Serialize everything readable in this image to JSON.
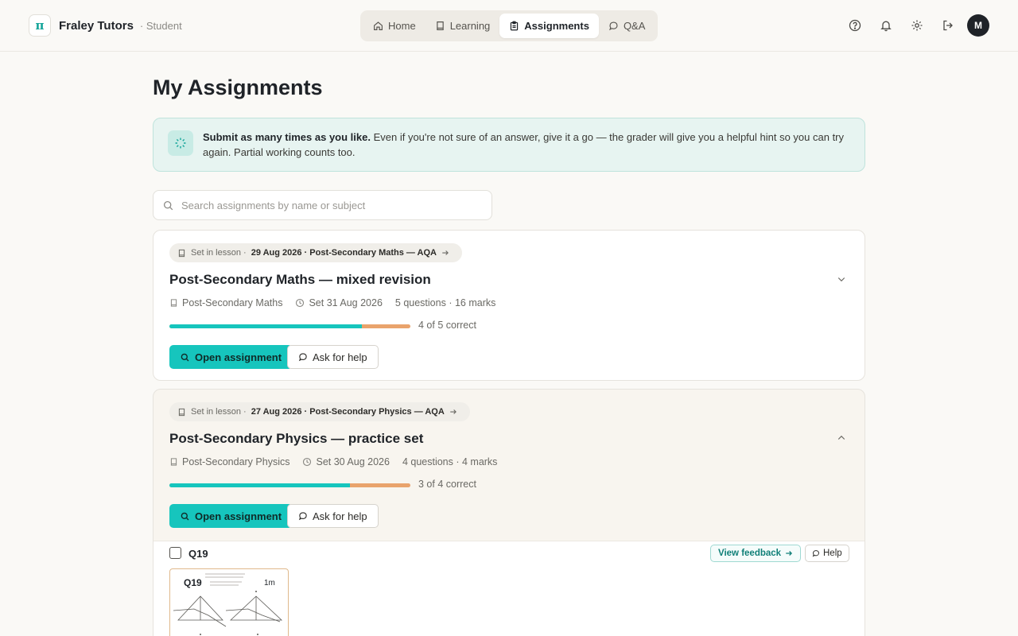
{
  "brand": {
    "logo_glyph": "π",
    "name": "Fraley Tutors",
    "role": "· Student"
  },
  "nav": {
    "tabs": [
      {
        "label": "Home",
        "icon": "home-icon"
      },
      {
        "label": "Learning",
        "icon": "book-icon"
      },
      {
        "label": "Assignments",
        "icon": "clipboard-icon",
        "active": true
      },
      {
        "label": "Q&A",
        "icon": "chat-icon"
      }
    ]
  },
  "topbar": {
    "icons": [
      "help-circle-icon",
      "bell-icon",
      "gear-icon",
      "logout-icon"
    ],
    "avatar_initial": "M"
  },
  "page": {
    "title": "My Assignments"
  },
  "info": {
    "bold": "Submit as many times as you like.",
    "text": " Even if you're not sure of an answer, give it a go — the grader will give you a helpful hint so you can try again. Partial working counts too."
  },
  "search": {
    "placeholder": "Search assignments by name or subject",
    "value": ""
  },
  "assignments": [
    {
      "lesson_prefix": "Set in lesson ·",
      "lesson_detail": "29 Aug 2026 · Post-Secondary Maths — AQA",
      "title": "Post-Secondary Maths — mixed revision",
      "subject": "Post-Secondary Maths",
      "set_date": "Set 31 Aug 2026",
      "counts": "5 questions · 16 marks",
      "progress_correct": 4,
      "progress_total": 5,
      "progress_label": "4 of 5 correct",
      "open_label": "Open assignment",
      "help_label": "Ask for help",
      "expanded": false
    },
    {
      "lesson_prefix": "Set in lesson ·",
      "lesson_detail": "27 Aug 2026 · Post-Secondary Physics — AQA",
      "title": "Post-Secondary Physics — practice set",
      "subject": "Post-Secondary Physics",
      "set_date": "Set 30 Aug 2026",
      "counts": "4 questions · 4 marks",
      "progress_correct": 3,
      "progress_total": 4,
      "progress_label": "3 of 4 correct",
      "open_label": "Open assignment",
      "help_label": "Ask for help",
      "expanded": true,
      "question": {
        "label": "Q19",
        "feedback_label": "View feedback",
        "help_label": "Help",
        "thumb_label": "Q19",
        "thumb_marks": "1m"
      }
    }
  ],
  "colors": {
    "accent": "#16c5bd",
    "progress_remaining": "#e9a36c",
    "info_bg": "#e7f4f1"
  }
}
